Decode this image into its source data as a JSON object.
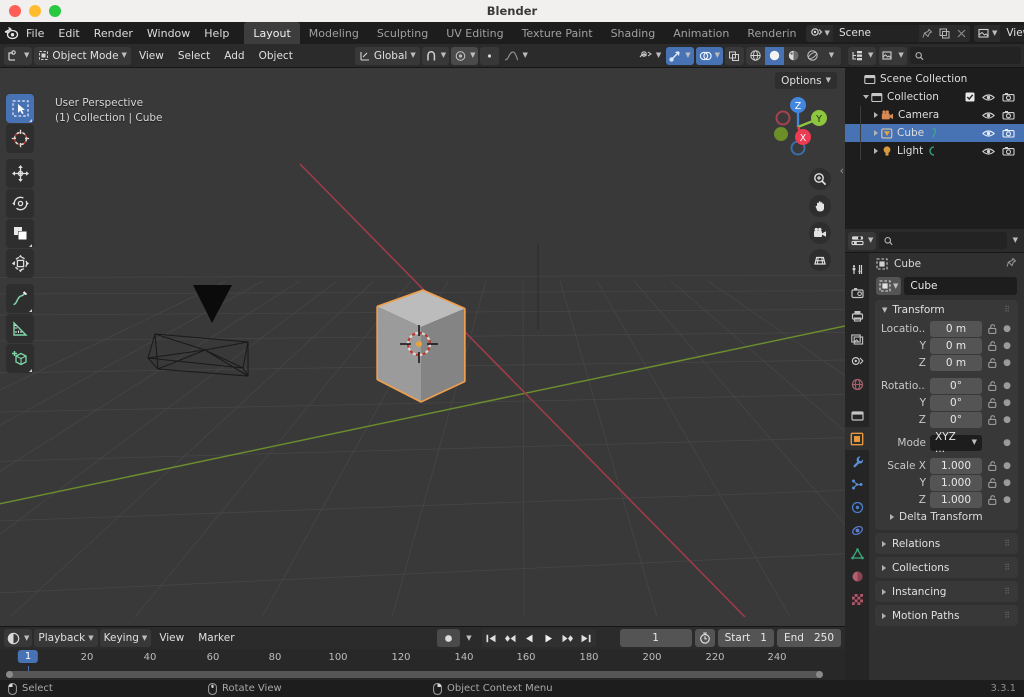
{
  "window": {
    "title": "Blender",
    "version": "3.3.1"
  },
  "menubar": {
    "logo": "blender-logo",
    "items": [
      "File",
      "Edit",
      "Render",
      "Window",
      "Help"
    ],
    "workspace_tabs": [
      {
        "label": "Layout",
        "active": true
      },
      {
        "label": "Modeling",
        "active": false
      },
      {
        "label": "Sculpting",
        "active": false
      },
      {
        "label": "UV Editing",
        "active": false
      },
      {
        "label": "Texture Paint",
        "active": false
      },
      {
        "label": "Shading",
        "active": false
      },
      {
        "label": "Animation",
        "active": false
      },
      {
        "label": "Renderin",
        "active": false
      }
    ],
    "scene": {
      "icon": "scene-icon",
      "name": "Scene",
      "pin_icon": "pin-icon",
      "copy_icon": "duplicate-icon",
      "close_icon": "x-icon"
    },
    "viewlayer": {
      "icon": "viewlayer-icon",
      "name": "ViewLayer",
      "copy_icon": "duplicate-icon",
      "close_icon": "x-icon"
    }
  },
  "viewport_header": {
    "editor_type_icon": "editor-type-icon",
    "mode": "Object Mode",
    "menus": [
      "View",
      "Select",
      "Add",
      "Object"
    ],
    "transform_orientation": {
      "icon": "orientation-icon",
      "label": "Global"
    },
    "snap_icon": "magnet-icon",
    "proportional_icon": "proportional-edit-icon",
    "falloff_icon": "falloff-icon",
    "visibility_icon": "visibility-icon",
    "gizmo_icon": "gizmo-icon",
    "overlays_icon": "overlays-icon",
    "xray_icon": "xray-icon",
    "shading": [
      {
        "name": "wireframe-shading",
        "active": false
      },
      {
        "name": "solid-shading",
        "active": true
      },
      {
        "name": "material-preview-shading",
        "active": false
      },
      {
        "name": "rendered-shading",
        "active": false
      }
    ]
  },
  "viewport": {
    "overlay_line1": "User Perspective",
    "overlay_line2": "(1) Collection | Cube",
    "options_label": "Options",
    "gizmo_axes": [
      {
        "label": "Z",
        "color": "#4286dd"
      },
      {
        "label": "Y",
        "color": "#8dc63f"
      },
      {
        "label": "X",
        "color": "#ec3b52"
      }
    ],
    "nav_buttons": [
      "zoom-icon",
      "pan-hand-icon",
      "camera-view-icon",
      "toggle-perspective-icon"
    ],
    "tools": [
      {
        "name": "tweak-select-box-tool",
        "active": true
      },
      {
        "name": "cursor-tool",
        "active": false
      },
      {
        "name": "move-tool",
        "active": false
      },
      {
        "name": "rotate-tool",
        "active": false
      },
      {
        "name": "scale-tool",
        "active": false
      },
      {
        "name": "transform-tool",
        "active": false
      },
      {
        "name": "annotate-tool",
        "active": false
      },
      {
        "name": "measure-tool",
        "active": false
      },
      {
        "name": "add-cube-tool",
        "active": false
      }
    ],
    "select_modes": [
      "set-select-mode",
      "extend-select-mode",
      "subtract-select-mode",
      "invert-select-mode",
      "intersect-select-mode"
    ],
    "objects": [
      "Camera",
      "Cube",
      "Light"
    ],
    "colors": {
      "x_axis": "#a33b4a",
      "y_axis": "#6b8b2f",
      "background": "#393939",
      "grid": "#4a4a4a",
      "selection": "#ed9e4e"
    }
  },
  "timeline": {
    "editor_icon": "timeline-editor-icon",
    "menus": [
      "Playback",
      "Keying",
      "View",
      "Marker"
    ],
    "record_icon": "record-icon",
    "transport": [
      "jump-to-start-icon",
      "jump-back-keyframe-icon",
      "play-reverse-icon",
      "play-icon",
      "jump-forward-keyframe-icon",
      "jump-to-end-icon"
    ],
    "current_frame": "1",
    "autokey_icon": "auto-keying-icon",
    "start_label": "Start",
    "start_value": "1",
    "end_label": "End",
    "end_value": "250",
    "ticks": [
      "20",
      "40",
      "60",
      "80",
      "100",
      "120",
      "140",
      "160",
      "180",
      "200",
      "220",
      "240"
    ],
    "playhead_frame": "1"
  },
  "outliner": {
    "display_mode_icon": "outliner-display-mode-icon",
    "filter_icon": "outliner-filter-icon",
    "search_placeholder": "",
    "search_value": "",
    "rows": [
      {
        "label": "Scene Collection",
        "icon": "scene-collection-icon",
        "depth": 0,
        "disclosure": "",
        "selected": false,
        "checkbox": false,
        "eye": false,
        "camera": false
      },
      {
        "label": "Collection",
        "icon": "collection-icon",
        "depth": 1,
        "disclosure": "down",
        "selected": false,
        "checkbox": true,
        "eye": true,
        "camera": true
      },
      {
        "label": "Camera",
        "icon": "camera-object-icon",
        "depth": 2,
        "disclosure": "right",
        "selected": false,
        "checkbox": false,
        "eye": true,
        "camera": true
      },
      {
        "label": "Cube",
        "icon": "mesh-object-icon",
        "depth": 2,
        "disclosure": "right",
        "selected": true,
        "checkbox": false,
        "eye": true,
        "camera": true
      },
      {
        "label": "Light",
        "icon": "light-object-icon",
        "depth": 2,
        "disclosure": "right",
        "selected": false,
        "checkbox": false,
        "eye": true,
        "camera": true
      }
    ]
  },
  "properties": {
    "editor_icon": "properties-editor-icon",
    "search_placeholder": "",
    "search_value": "",
    "options_chevron": "chevron-down-icon",
    "tabs": [
      {
        "name": "tool-tab",
        "active": false
      },
      {
        "name": "render-tab",
        "active": false
      },
      {
        "name": "output-tab",
        "active": false
      },
      {
        "name": "view-layer-tab",
        "active": false
      },
      {
        "name": "scene-tab",
        "active": false
      },
      {
        "name": "world-tab",
        "active": false
      },
      {
        "name": "collection-tab",
        "active": false
      },
      {
        "name": "object-tab",
        "active": true
      },
      {
        "name": "modifiers-tab",
        "active": false
      },
      {
        "name": "particles-tab",
        "active": false
      },
      {
        "name": "physics-tab",
        "active": false
      },
      {
        "name": "constraints-tab",
        "active": false
      },
      {
        "name": "object-data-tab",
        "active": false
      },
      {
        "name": "material-tab",
        "active": false
      },
      {
        "name": "texture-tab",
        "active": false
      }
    ],
    "breadcrumb": {
      "icon": "object-icon",
      "text": "Cube",
      "pin": "pin-icon"
    },
    "name_field": {
      "icon": "object-icon",
      "value": "Cube"
    },
    "transform": {
      "title": "Transform",
      "rows": [
        {
          "label": "Locatio...",
          "value": "0 m",
          "lock": true,
          "anim": true
        },
        {
          "label": "Y",
          "value": "0 m",
          "lock": true,
          "anim": true
        },
        {
          "label": "Z",
          "value": "0 m",
          "lock": true,
          "anim": true
        },
        {
          "label": "Rotatio...",
          "value": "0°",
          "lock": true,
          "anim": true
        },
        {
          "label": "Y",
          "value": "0°",
          "lock": true,
          "anim": true
        },
        {
          "label": "Z",
          "value": "0°",
          "lock": true,
          "anim": true
        },
        {
          "label": "Mode",
          "value": "XYZ ...",
          "lock": false,
          "anim": true,
          "dropdown": true
        },
        {
          "label": "Scale X",
          "value": "1.000",
          "lock": true,
          "anim": true
        },
        {
          "label": "Y",
          "value": "1.000",
          "lock": true,
          "anim": true
        },
        {
          "label": "Z",
          "value": "1.000",
          "lock": true,
          "anim": true
        }
      ],
      "sub_panel": "Delta Transform"
    },
    "closed_panels": [
      "Relations",
      "Collections",
      "Instancing",
      "Motion Paths"
    ]
  },
  "statusbar": {
    "items": [
      {
        "icon": "mouse-left-icon",
        "label": "Select"
      },
      {
        "icon": "mouse-middle-icon",
        "label": "Rotate View"
      },
      {
        "icon": "mouse-right-icon",
        "label": "Object Context Menu"
      }
    ]
  }
}
